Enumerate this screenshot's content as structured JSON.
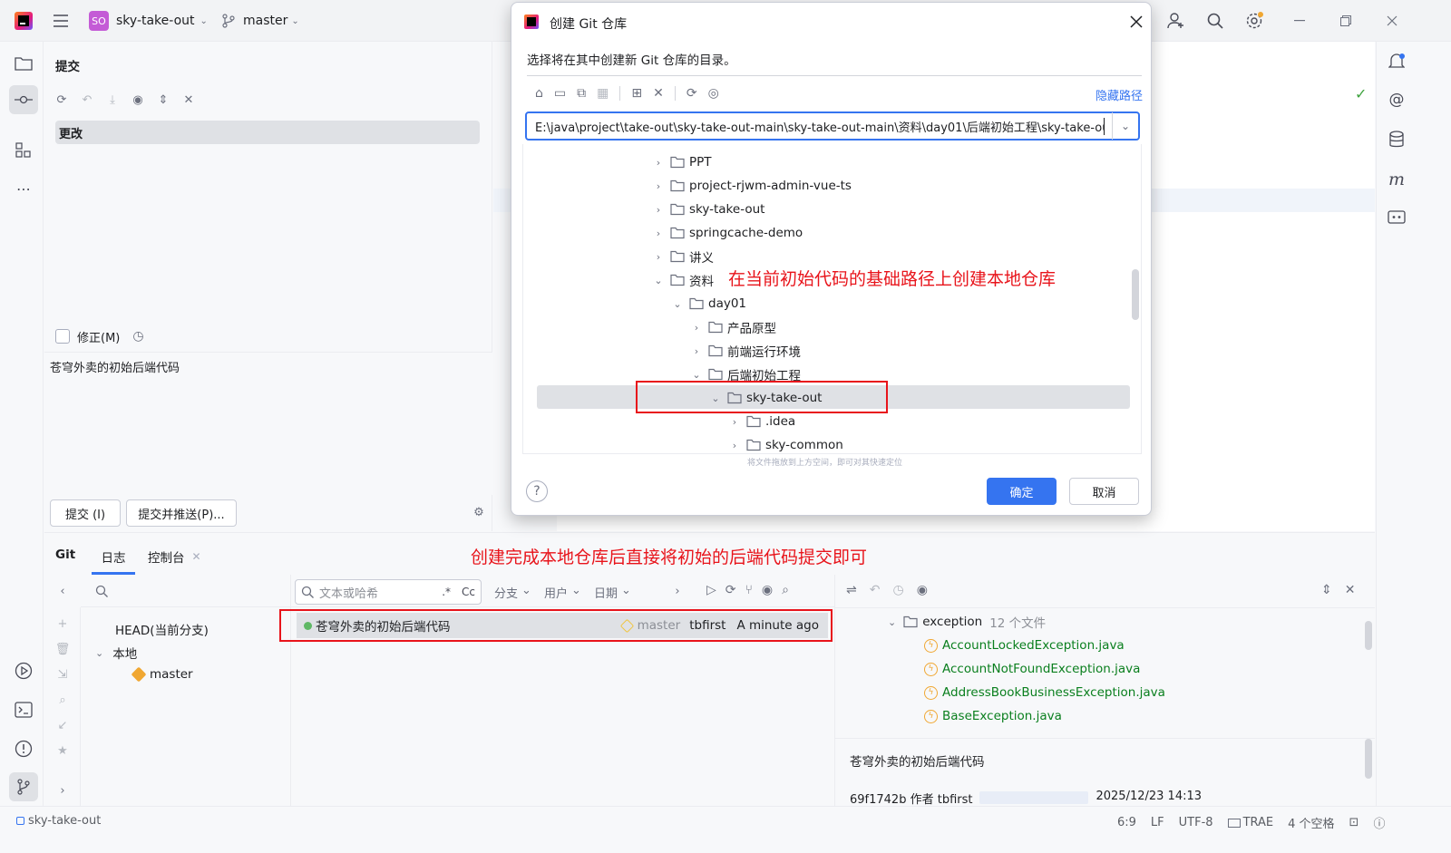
{
  "titlebar": {
    "project_badge": "SO",
    "project_name": "sky-take-out",
    "branch": "master"
  },
  "commit_panel": {
    "title": "提交",
    "changes_label": "更改",
    "amend_label": "修正(M)",
    "message": "苍穹外卖的初始后端代码",
    "commit_button": "提交 (I)",
    "commit_push_button": "提交并推送(P)..."
  },
  "dialog": {
    "title": "创建 Git 仓库",
    "prompt": "选择将在其中创建新 Git 仓库的目录。",
    "hide_path_link": "隐藏路径",
    "path_value": "E:\\java\\project\\take-out\\sky-take-out-main\\sky-take-out-main\\资料\\day01\\后端初始工程\\sky-take-out",
    "tree": [
      {
        "label": "PPT",
        "expanded": false
      },
      {
        "label": "project-rjwm-admin-vue-ts",
        "expanded": false
      },
      {
        "label": "sky-take-out",
        "expanded": false
      },
      {
        "label": "springcache-demo",
        "expanded": false
      },
      {
        "label": "讲义",
        "expanded": false
      },
      {
        "label": "资料",
        "expanded": true
      },
      {
        "label": "day01",
        "expanded": true
      },
      {
        "label": "产品原型",
        "expanded": false
      },
      {
        "label": "前端运行环境",
        "expanded": false
      },
      {
        "label": "后端初始工程",
        "expanded": true
      },
      {
        "label": "sky-take-out",
        "expanded": true,
        "selected": true
      },
      {
        "label": ".idea",
        "expanded": false
      },
      {
        "label": "sky-common",
        "expanded": false
      }
    ],
    "drop_hint": "将文件拖放到上方空间，即可对其快速定位",
    "ok_button": "确定",
    "cancel_button": "取消"
  },
  "annotations": {
    "dialog_note": "在当前初始代码的基础路径上创建本地仓库",
    "bottom_note": "创建完成本地仓库后直接将初始的后端代码提交即可"
  },
  "git_panel": {
    "tabs": [
      "Git",
      "日志",
      "控制台"
    ],
    "branches": {
      "head": "HEAD(当前分支)",
      "local": "本地",
      "master": "master"
    },
    "log_filter": {
      "search_placeholder": "文本或哈希",
      "regex": ".*",
      "case": "Cc",
      "branch": "分支",
      "user": "用户",
      "date": "日期"
    },
    "commit": {
      "message": "苍穹外卖的初始后端代码",
      "branch_tag": "master",
      "author": "tbfirst",
      "time": "A minute ago"
    },
    "files": {
      "folder": "exception",
      "count": "12 个文件",
      "items": [
        "AccountLockedException.java",
        "AccountNotFoundException.java",
        "AddressBookBusinessException.java",
        "BaseException.java"
      ]
    },
    "details": {
      "message": "苍穹外卖的初始后端代码",
      "hash_author": "69f1742b 作者 tbfirst",
      "date": "2025/12/23 14:13"
    }
  },
  "statusbar": {
    "project": "sky-take-out",
    "position": "6:9",
    "line_sep": "LF",
    "encoding": "UTF-8",
    "plugin": "TRAE",
    "indent": "4 个空格"
  },
  "colors": {
    "accent": "#3574f0",
    "annotation_red": "#e8141b",
    "file_green": "#0a7f1e",
    "badge": "#c45bd6"
  }
}
